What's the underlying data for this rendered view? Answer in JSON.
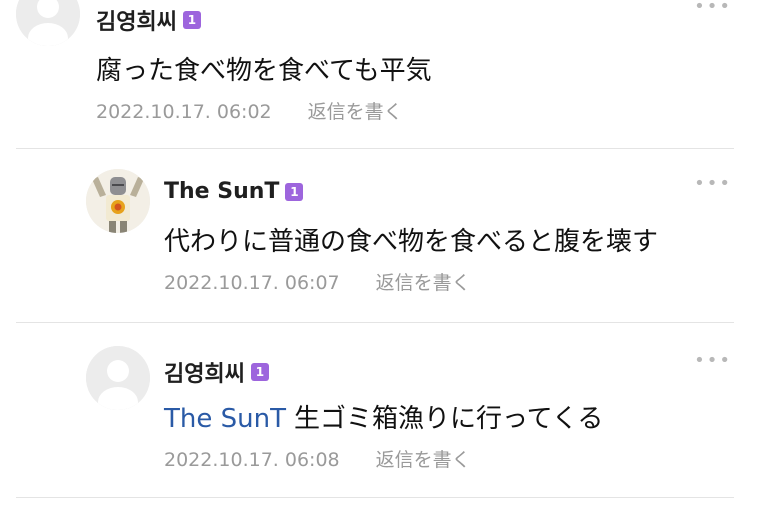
{
  "comments": [
    {
      "author": "김영희씨",
      "badge": "1",
      "mention": "",
      "text": "腐った食べ物を食べても平気",
      "timestamp": "2022.10.17. 06:02",
      "reply_label": "返信を書く"
    },
    {
      "author": "The SunT",
      "badge": "1",
      "mention": "",
      "text": "代わりに普通の食べ物を食べると腹を壊す",
      "timestamp": "2022.10.17. 06:07",
      "reply_label": "返信を書く"
    },
    {
      "author": "김영희씨",
      "badge": "1",
      "mention": "The SunT",
      "text": "生ゴミ箱漁りに行ってくる",
      "timestamp": "2022.10.17. 06:08",
      "reply_label": "返信を書く"
    }
  ],
  "more_menu_label": "•••",
  "icons": {
    "default_avatar": "default-avatar-icon",
    "custom_avatar": "sun-knight-avatar",
    "more": "more-dots-icon"
  },
  "colors": {
    "badge": "#9d65dd",
    "mention": "#2a5aa6",
    "meta": "#9a9a9a"
  }
}
